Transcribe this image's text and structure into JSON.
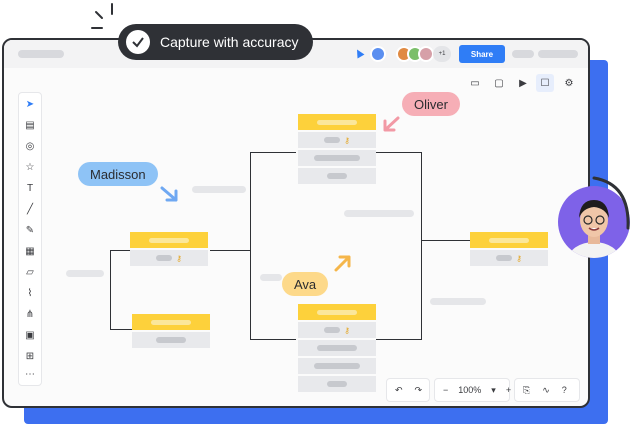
{
  "callout": {
    "text": "Capture with accuracy"
  },
  "header": {
    "share_label": "Share",
    "collaborator_count": "+1"
  },
  "bottom_toolbar": {
    "zoom": "100%",
    "zoom_out": "−",
    "zoom_in": "+"
  },
  "labels": {
    "madisson": "Madisson",
    "oliver": "Oliver",
    "ava": "Ava"
  },
  "colors": {
    "accent_blue": "#3d6ff0",
    "share_blue": "#2f7df6",
    "madisson_bubble": "#8ec3f6",
    "oliver_bubble": "#f6aeb6",
    "ava_bubble": "#fdd98a",
    "card_header": "#fdd13b",
    "presenter_bg": "#7e62e8"
  },
  "icons": {
    "left_rail": [
      "pointer-icon",
      "note-icon",
      "shapes-icon",
      "star-icon",
      "text-icon",
      "line-icon",
      "pen-icon",
      "table-icon",
      "sticky-icon",
      "chart-icon",
      "diagram-icon",
      "image-icon",
      "embed-icon",
      "more-icon"
    ],
    "top_right": [
      "layers-icon",
      "comment-icon",
      "video-icon",
      "chat-icon",
      "settings-icon"
    ]
  }
}
